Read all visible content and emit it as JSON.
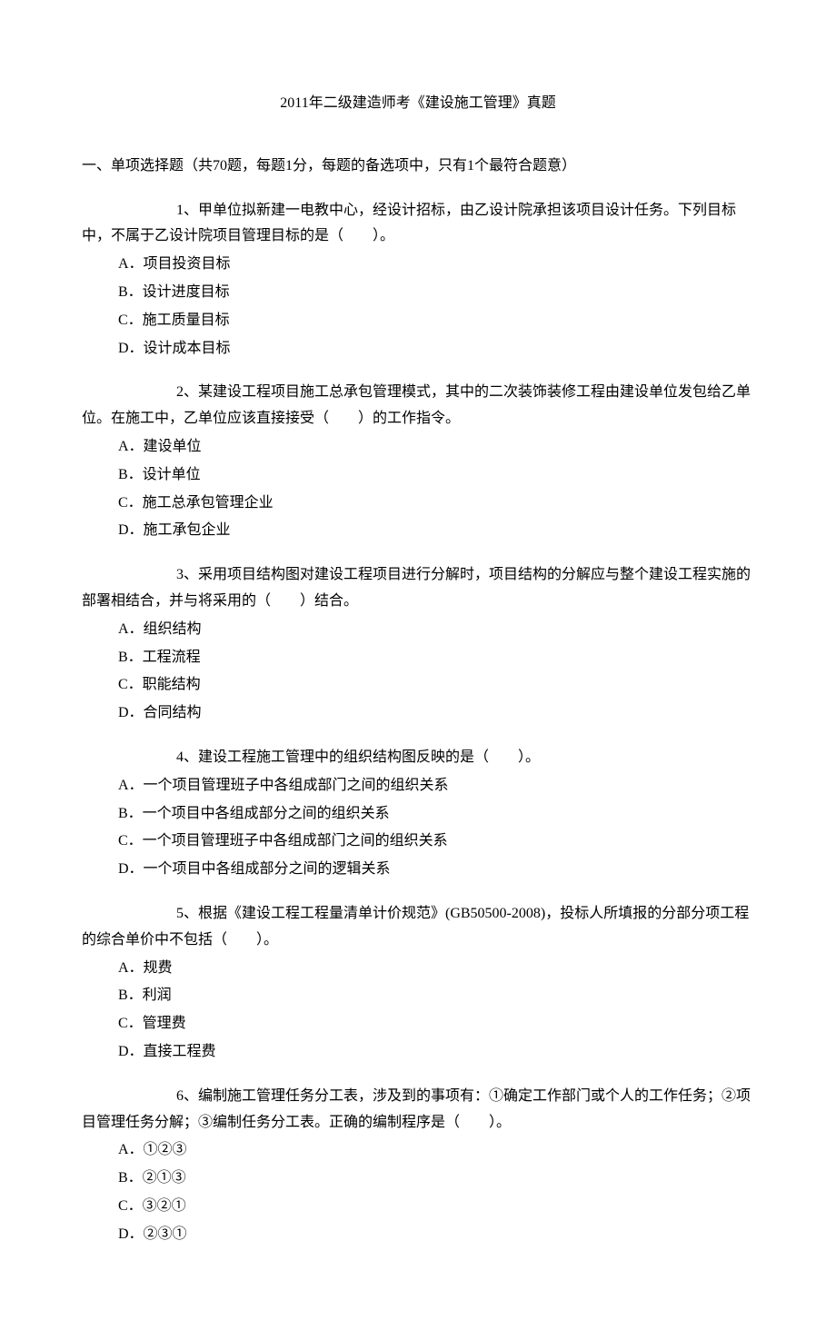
{
  "title": "2011年二级建造师考《建设施工管理》真题",
  "section_header": "一、单项选择题（共70题，每题1分，每题的备选项中，只有1个最符合题意）",
  "questions": [
    {
      "text": "1、甲单位拟新建一电教中心，经设计招标，由乙设计院承担该项目设计任务。下列目标中，不属于乙设计院项目管理目标的是（　　）。",
      "options": [
        "A．项目投资目标",
        "B．设计进度目标",
        "C．施工质量目标",
        "D．设计成本目标"
      ]
    },
    {
      "text": "2、某建设工程项目施工总承包管理模式，其中的二次装饰装修工程由建设单位发包给乙单位。在施工中，乙单位应该直接接受（　　）的工作指令。",
      "options": [
        "A．建设单位",
        "B．设计单位",
        "C．施工总承包管理企业",
        "D．施工承包企业"
      ]
    },
    {
      "text": "3、采用项目结构图对建设工程项目进行分解时，项目结构的分解应与整个建设工程实施的部署相结合，并与将采用的（　　）结合。",
      "options": [
        "A．组织结构",
        "B．工程流程",
        "C．职能结构",
        "D．合同结构"
      ]
    },
    {
      "text": "4、建设工程施工管理中的组织结构图反映的是（　　）。",
      "options": [
        "A．一个项目管理班子中各组成部门之间的组织关系",
        "B．一个项目中各组成部分之间的组织关系",
        "C．一个项目管理班子中各组成部门之间的组织关系",
        "D．一个项目中各组成部分之间的逻辑关系"
      ]
    },
    {
      "text": "5、根据《建设工程工程量清单计价规范》(GB50500-2008)，投标人所填报的分部分项工程的综合单价中不包括（　　）。",
      "options": [
        "A．规费",
        "B．利润",
        "C．管理费",
        "D．直接工程费"
      ]
    },
    {
      "text": "6、编制施工管理任务分工表，涉及到的事项有：①确定工作部门或个人的工作任务；②项目管理任务分解；③编制任务分工表。正确的编制程序是（　　）。",
      "options": [
        "A．①②③",
        "B．②①③",
        "C．③②①",
        "D．②③①"
      ]
    }
  ]
}
